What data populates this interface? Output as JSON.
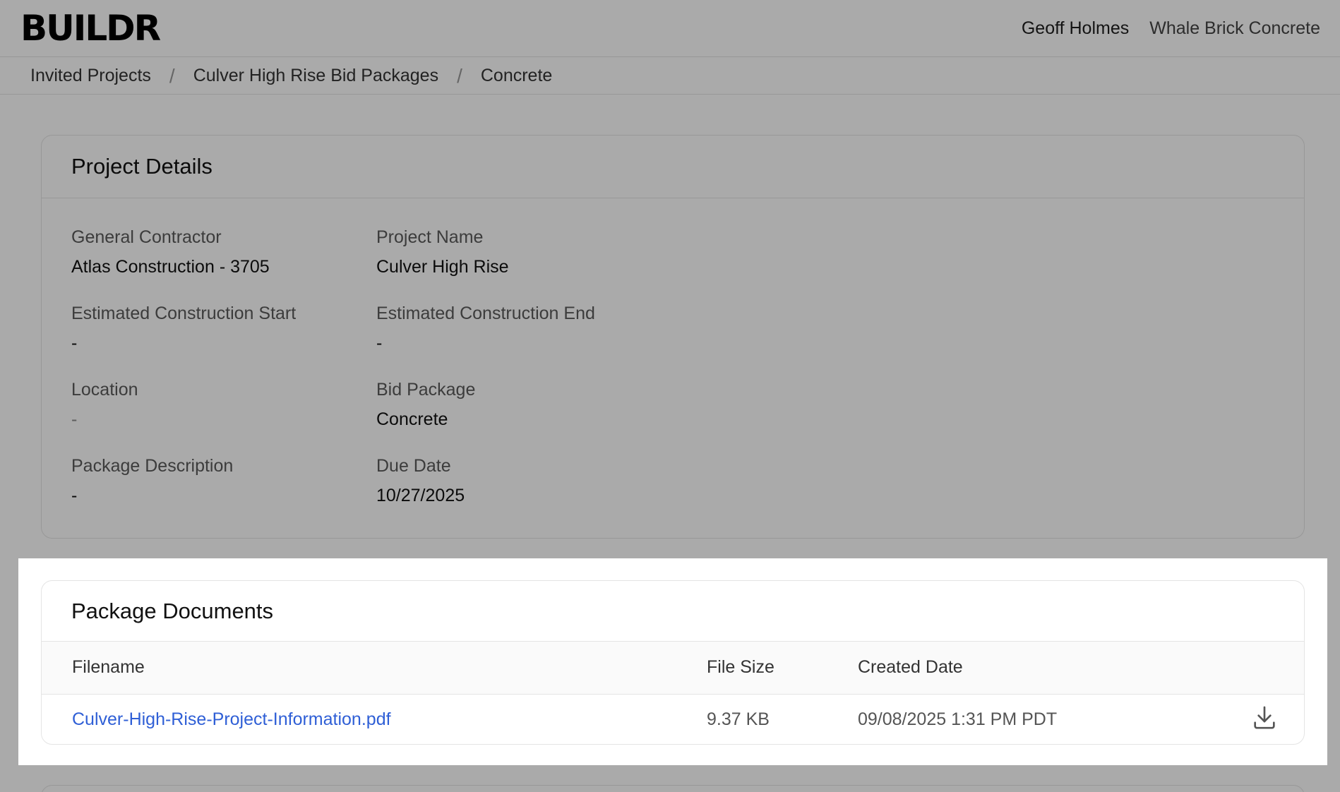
{
  "header": {
    "logo": "BUILDR",
    "user_name": "Geoff Holmes",
    "company_name": "Whale Brick Concrete"
  },
  "breadcrumb": {
    "items": [
      "Invited Projects",
      "Culver High Rise Bid Packages",
      "Concrete"
    ],
    "separator": "/"
  },
  "project_details": {
    "title": "Project Details",
    "fields": {
      "general_contractor": {
        "label": "General Contractor",
        "value": "Atlas Construction - 3705"
      },
      "project_name": {
        "label": "Project Name",
        "value": "Culver High Rise"
      },
      "est_start": {
        "label": "Estimated Construction Start",
        "value": "-"
      },
      "est_end": {
        "label": "Estimated Construction End",
        "value": "-"
      },
      "location": {
        "label": "Location",
        "value": "-"
      },
      "bid_package": {
        "label": "Bid Package",
        "value": "Concrete"
      },
      "package_description": {
        "label": "Package Description",
        "value": "-"
      },
      "due_date": {
        "label": "Due Date",
        "value": "10/27/2025"
      }
    }
  },
  "package_documents": {
    "title": "Package Documents",
    "columns": {
      "filename": "Filename",
      "file_size": "File Size",
      "created_date": "Created Date"
    },
    "rows": [
      {
        "filename": "Culver-High-Rise-Project-Information.pdf",
        "file_size": "9.37 KB",
        "created_date": "09/08/2025 1:31 PM PDT",
        "action_icon": "download-icon"
      }
    ]
  },
  "colors": {
    "link": "#2f5fd6",
    "overlay": "rgba(0,0,0,0.335)"
  }
}
